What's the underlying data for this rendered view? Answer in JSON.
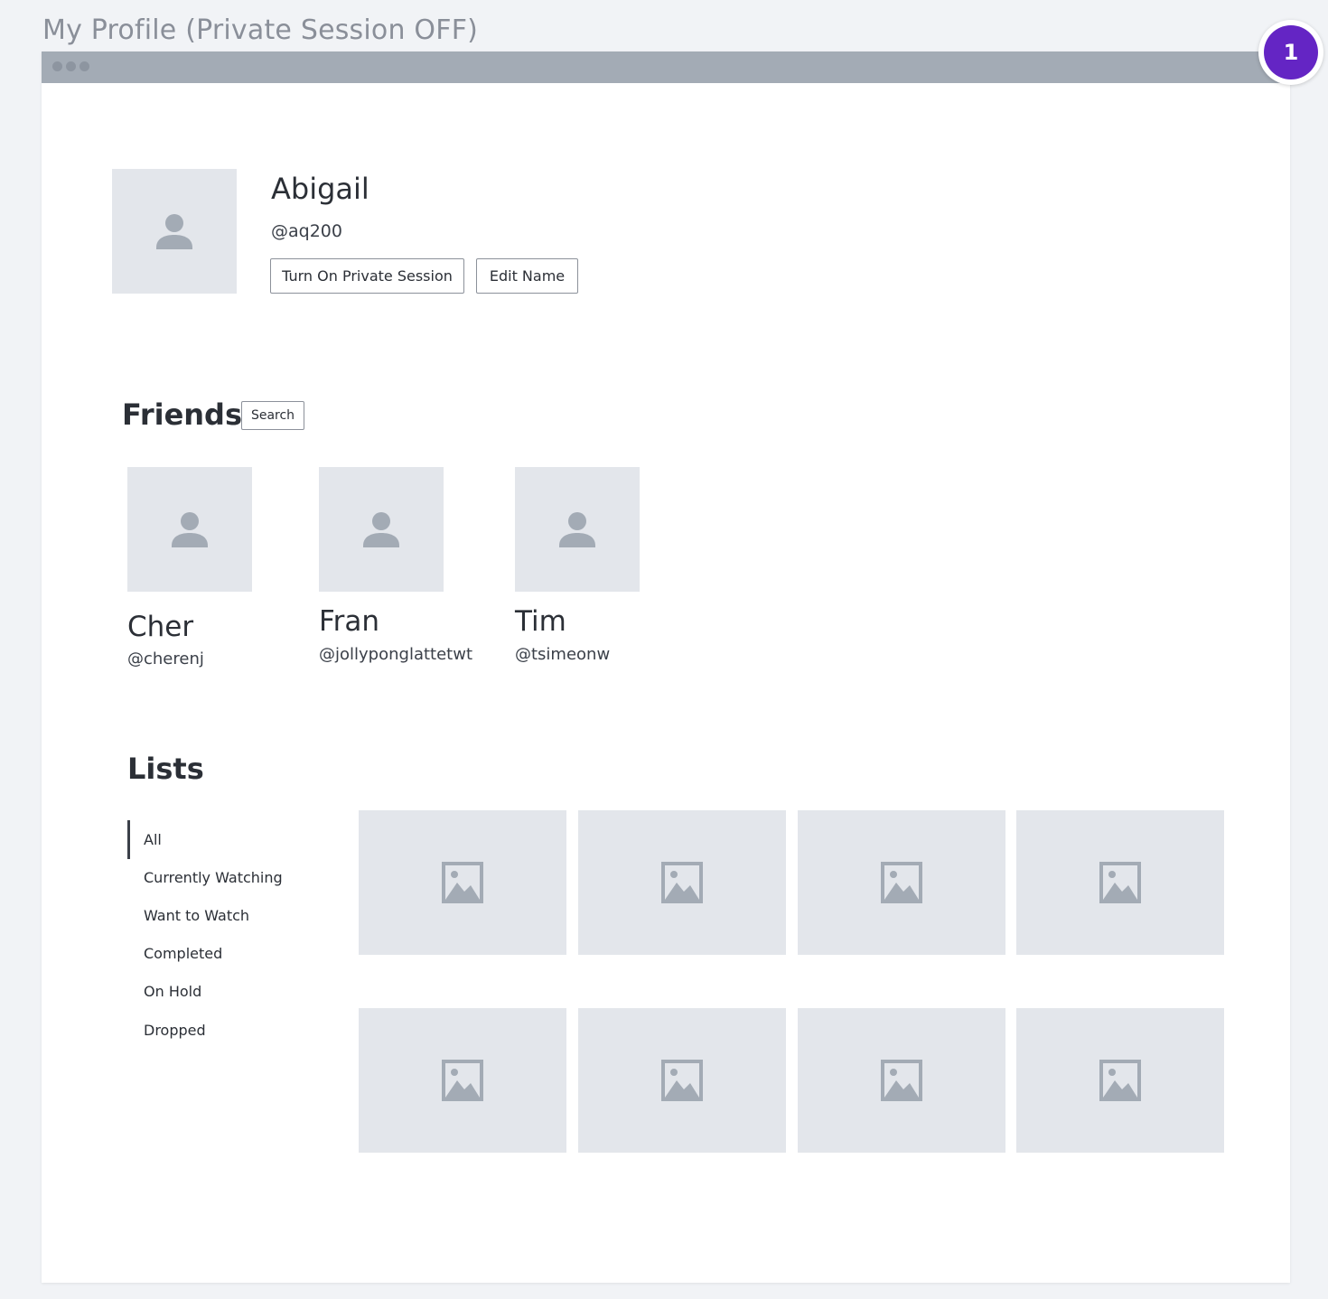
{
  "page": {
    "title": "My Profile (Private Session OFF)"
  },
  "badge": {
    "number": "1",
    "color": "#6425c4"
  },
  "profile": {
    "name": "Abigail",
    "handle": "@aq200",
    "private_session_label": "Turn On Private Session",
    "edit_name_label": "Edit Name"
  },
  "friends": {
    "title": "Friends",
    "search_label": "Search",
    "items": [
      {
        "name": "Cher",
        "handle": "@cherenj"
      },
      {
        "name": "Fran",
        "handle": "@jollyponglattetwt"
      },
      {
        "name": "Tim",
        "handle": "@tsimeonw"
      }
    ]
  },
  "lists": {
    "title": "Lists",
    "categories": [
      {
        "label": "All",
        "active": true
      },
      {
        "label": "Currently Watching",
        "active": false
      },
      {
        "label": "Want to Watch",
        "active": false
      },
      {
        "label": "Completed",
        "active": false
      },
      {
        "label": "On Hold",
        "active": false
      },
      {
        "label": "Dropped",
        "active": false
      }
    ],
    "tiles": [
      "image-placeholder",
      "image-placeholder",
      "image-placeholder",
      "image-placeholder",
      "image-placeholder",
      "image-placeholder",
      "image-placeholder",
      "image-placeholder"
    ]
  },
  "icons": {
    "avatar": "person-icon",
    "tile": "image-icon"
  },
  "colors": {
    "placeholder_bg": "#e3e6eb",
    "icon": "#a3abb5",
    "accent": "#6425c4"
  }
}
